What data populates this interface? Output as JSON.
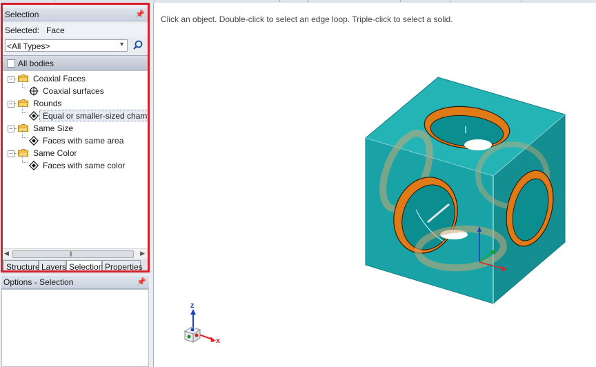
{
  "selection_panel": {
    "title": "Selection",
    "selected_label": "Selected:",
    "selected_value": "Face",
    "type_filter": "<All Types>",
    "all_bodies_label": "All bodies",
    "all_bodies_checked": false,
    "tree": [
      {
        "group": "Coaxial Faces",
        "child": "Coaxial surfaces",
        "child_icon": "crosshair-icon"
      },
      {
        "group": "Rounds",
        "child": "Equal or smaller-sized chamfers",
        "child_icon": "diamond-icon",
        "selected": true
      },
      {
        "group": "Same Size",
        "child": "Faces with same area",
        "child_icon": "diamond-icon"
      },
      {
        "group": "Same Color",
        "child": "Faces with same color",
        "child_icon": "diamond-icon"
      }
    ],
    "tabs": [
      "Structure",
      "Layers",
      "Selection",
      "Properties"
    ],
    "active_tab": "Selection"
  },
  "options_panel": {
    "title": "Options - Selection"
  },
  "viewport": {
    "hint": "Click an object. Double-click to select an edge loop. Triple-click to select a solid.",
    "axis_labels": {
      "z": "z",
      "x": "x"
    },
    "colors": {
      "solid": "#1aa3a6",
      "face_highlight": "#e07a16",
      "axis_x": "#e02020",
      "axis_y": "#20a020",
      "axis_z": "#1a3fbf"
    }
  },
  "colors": {
    "highlight_border": "#d7202a",
    "panel_bg": "#e9ecf1"
  }
}
